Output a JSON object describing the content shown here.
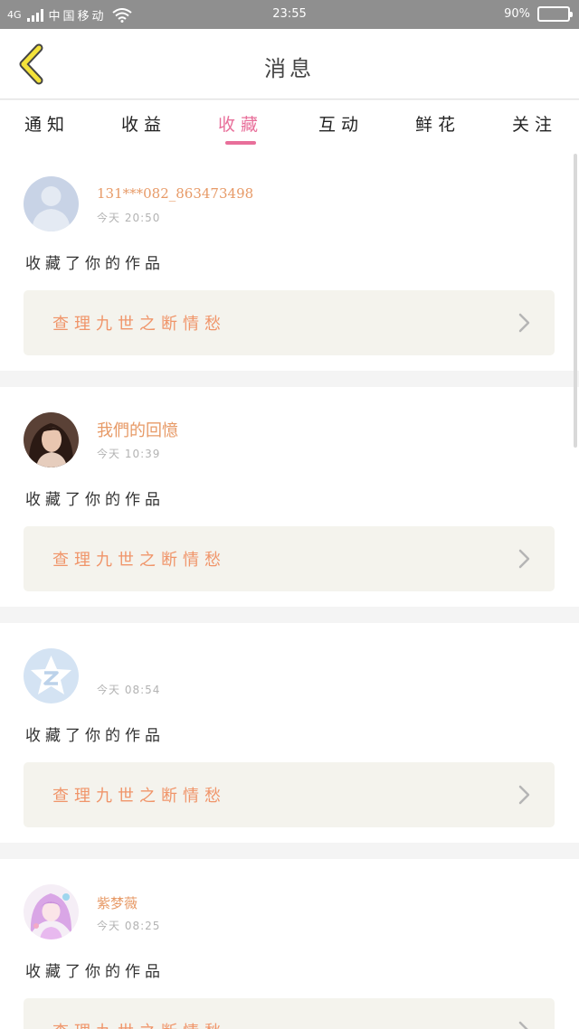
{
  "status_bar": {
    "network": "4G",
    "carrier": "中国移动",
    "time": "23:55",
    "battery_percent": "90%",
    "battery_level": 0.9,
    "icons": [
      "signal-icon",
      "wifi-icon",
      "battery-icon"
    ]
  },
  "header": {
    "title": "消息",
    "back_icon": "chevron-left-icon"
  },
  "tabs": [
    {
      "label": "通知",
      "active": false
    },
    {
      "label": "收益",
      "active": false
    },
    {
      "label": "收藏",
      "active": true
    },
    {
      "label": "互动",
      "active": false
    },
    {
      "label": "鲜花",
      "active": false
    },
    {
      "label": "关注",
      "active": false
    }
  ],
  "colors": {
    "accent_pink": "#e86f9a",
    "name_orange": "#e79a67",
    "work_orange": "#f0956a",
    "card_box_bg": "#f4f3ed"
  },
  "items": [
    {
      "user_name": "131***082_863473498",
      "time": "今天 20:50",
      "action": "收藏了你的作品",
      "work_title": "查理九世之断情愁",
      "avatar": "default-avatar-icon"
    },
    {
      "user_name": "我們的回憶",
      "time": "今天 10:39",
      "action": "收藏了你的作品",
      "work_title": "查理九世之断情愁",
      "avatar": "photo-avatar"
    },
    {
      "user_name": "",
      "time": "今天 08:54",
      "action": "收藏了你的作品",
      "work_title": "查理九世之断情愁",
      "avatar": "qzone-avatar-icon"
    },
    {
      "user_name": "紫梦薇",
      "time": "今天 08:25",
      "action": "收藏了你的作品",
      "work_title": "查理九世之断情愁",
      "avatar": "anime-avatar"
    }
  ]
}
